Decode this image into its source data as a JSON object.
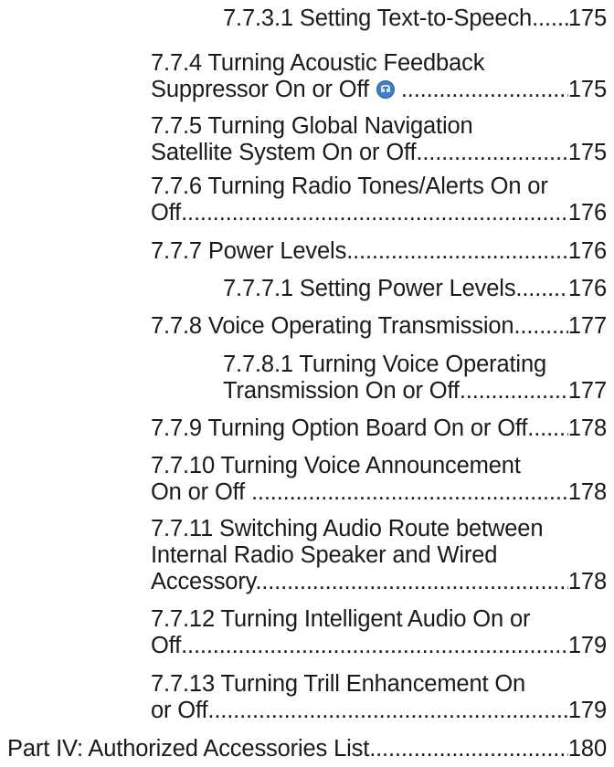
{
  "dot_leader": "..............................................................................................................................................................",
  "entries": [
    {
      "lines": [
        "7.7.3.1 Setting Text-to-Speech"
      ],
      "page": "175"
    },
    {
      "lines": [
        "7.7.4 Turning Acoustic Feedback",
        "Suppressor On or Off"
      ],
      "page": "175",
      "icon": "premium-feature-icon"
    },
    {
      "lines": [
        "7.7.5 Turning Global Navigation",
        "Satellite System On or Off"
      ],
      "page": "175"
    },
    {
      "lines": [
        "7.7.6 Turning Radio Tones/Alerts On or",
        "Off"
      ],
      "page": "176"
    },
    {
      "lines": [
        "7.7.7 Power Levels"
      ],
      "page": "176"
    },
    {
      "lines": [
        "7.7.7.1 Setting Power Levels"
      ],
      "page": "176"
    },
    {
      "lines": [
        "7.7.8 Voice Operating Transmission"
      ],
      "page": "177"
    },
    {
      "lines": [
        "7.7.8.1 Turning Voice Operating",
        "Transmission On or Off"
      ],
      "page": "177"
    },
    {
      "lines": [
        "7.7.9 Turning Option Board On or Off"
      ],
      "page": "178"
    },
    {
      "lines": [
        "7.7.10 Turning Voice Announcement",
        "On or Off "
      ],
      "page": "178"
    },
    {
      "lines": [
        "7.7.11 Switching Audio Route between",
        "Internal Radio Speaker and Wired",
        "Accessory"
      ],
      "page": "178"
    },
    {
      "lines": [
        "7.7.12 Turning Intelligent Audio On or",
        "Off"
      ],
      "page": "179"
    },
    {
      "lines": [
        "7.7.13 Turning Trill Enhancement On",
        "or Off"
      ],
      "page": "179"
    },
    {
      "lines": [
        "Part IV: Authorized Accessories List"
      ],
      "page": "180"
    }
  ]
}
